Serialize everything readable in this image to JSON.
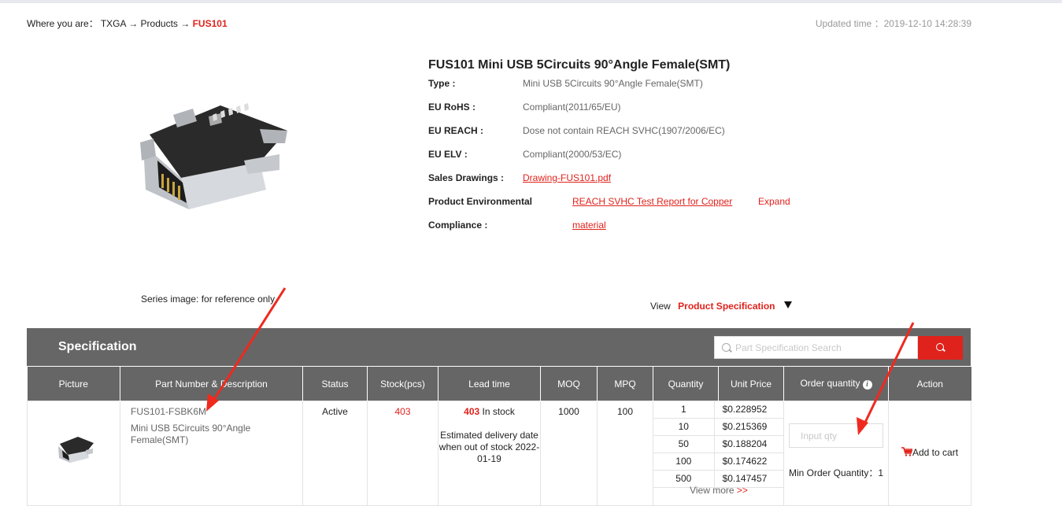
{
  "breadcrumb": {
    "prefix": "Where you are：",
    "items": [
      "TXGA",
      "Products"
    ],
    "separator": "→",
    "current": "FUS101"
  },
  "updated": "Updated time ：2019-12-10 14:28:39",
  "product": {
    "title": "FUS101 Mini USB 5Circuits 90°Angle Female(SMT)",
    "image_caption": "Series image: for reference only",
    "fields": {
      "type_label": "Type :",
      "type_value": "Mini USB 5Circuits 90°Angle Female(SMT)",
      "rohs_label": "EU RoHS :",
      "rohs_value": "Compliant(2011/65/EU)",
      "reach_label": "EU REACH :",
      "reach_value": "Dose not contain REACH SVHC(1907/2006/EC)",
      "elv_label": "EU ELV :",
      "elv_value": "Compliant(2000/53/EC)",
      "drawings_label": "Sales Drawings :",
      "drawings_link": "Drawing-FUS101.pdf",
      "env_label": "Product Environmental",
      "env_link": "REACH SVHC Test Report for Copper",
      "expand": "Expand",
      "compliance_label": "Compliance :",
      "compliance_link": "material"
    }
  },
  "view": {
    "label": "View",
    "option": "Product Specification"
  },
  "spec": {
    "title": "Specification",
    "search_placeholder": "Part Specification Search",
    "columns": [
      "Picture",
      "Part Number & Description",
      "Status",
      "Stock(pcs)",
      "Lead time",
      "MOQ",
      "MPQ",
      "Quantity",
      "Unit Price",
      "Order quantity",
      "Action"
    ],
    "row": {
      "part_number": "FUS101-FSBK6M",
      "description": "Mini USB 5Circuits 90°Angle Female(SMT)",
      "status": "Active",
      "stock": "403",
      "lead_stock_num": "403",
      "lead_stock_text": " In stock",
      "lead_estimate": "Estimated delivery date when out of stock 2022-01-19",
      "moq": "1000",
      "mpq": "100",
      "price_breaks": [
        {
          "qty": "1",
          "price": "$0.228952"
        },
        {
          "qty": "10",
          "price": "$0.215369"
        },
        {
          "qty": "50",
          "price": "$0.188204"
        },
        {
          "qty": "100",
          "price": "$0.174622"
        },
        {
          "qty": "500",
          "price": "$0.147457"
        }
      ],
      "view_more": "View more",
      "view_more_arrow": ">>",
      "qty_placeholder": "Input qty",
      "min_order": "Min Order Quantity：1",
      "add_to_cart": "Add to cart"
    }
  },
  "colors": {
    "accent": "#e0221c",
    "header_bg": "#666666",
    "annotation_arrow": "#ee2a1f"
  }
}
